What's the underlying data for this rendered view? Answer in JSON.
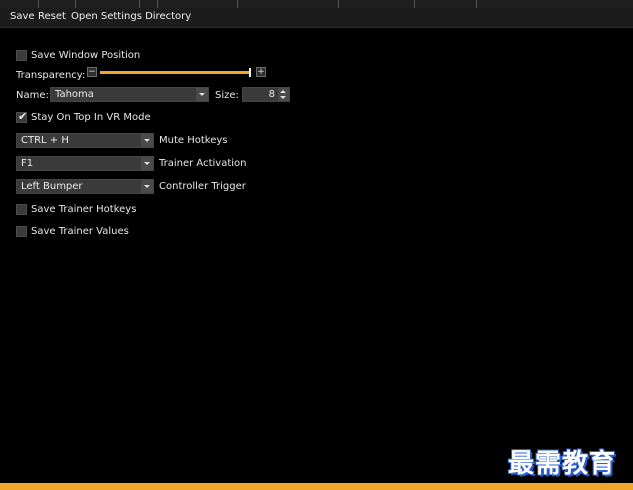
{
  "menu": {
    "save": "Save",
    "reset": "Reset",
    "open_settings": "Open Settings Directory"
  },
  "settings": {
    "save_window_position": {
      "label": "Save Window Position",
      "checked": false
    },
    "transparency": {
      "label": "Transparency:",
      "minus": "−",
      "plus": "+",
      "value_fraction": 1.0
    },
    "font_name": {
      "label": "Name:",
      "value": "Tahoma"
    },
    "font_size": {
      "label": "Size:",
      "value": "8"
    },
    "stay_on_top_vr": {
      "label": "Stay On Top In VR Mode",
      "checked": true
    },
    "mute_hotkeys": {
      "value": "CTRL + H",
      "label": "Mute Hotkeys"
    },
    "trainer_activation": {
      "value": "F1",
      "label": "Trainer Activation"
    },
    "controller_trigger": {
      "value": "Left Bumper",
      "label": "Controller Trigger"
    },
    "save_trainer_hotkeys": {
      "label": "Save Trainer Hotkeys",
      "checked": false
    },
    "save_trainer_values": {
      "label": "Save Trainer Values",
      "checked": false
    }
  },
  "watermark": "最需教育",
  "colors": {
    "accent": "#f0a62a",
    "background": "#000000",
    "control": "#3a3a3a",
    "text": "#e8e8e8"
  },
  "icons": {
    "check": "check-icon",
    "dropdown": "chevron-down-icon",
    "spin": "spinner-arrows-icon"
  }
}
